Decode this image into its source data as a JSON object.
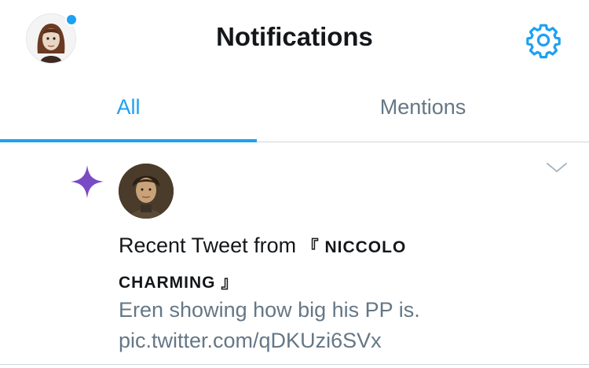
{
  "header": {
    "title": "Notifications",
    "avatar_icon": "user-avatar",
    "settings_icon": "gear-icon",
    "accent": "#1da1f2"
  },
  "tabs": [
    {
      "label": "All",
      "active": true
    },
    {
      "label": "Mentions",
      "active": false
    }
  ],
  "notification": {
    "icon": "sparkle-icon",
    "icon_color": "#794bc4",
    "prefix": "Recent Tweet from",
    "author_name": "『 Niccolo Charming 』",
    "tweet_line1": "Eren showing how big his PP is.",
    "tweet_line2": "pic.twitter.com/qDKUzi6SVx",
    "menu_icon": "chevron-down-icon"
  }
}
